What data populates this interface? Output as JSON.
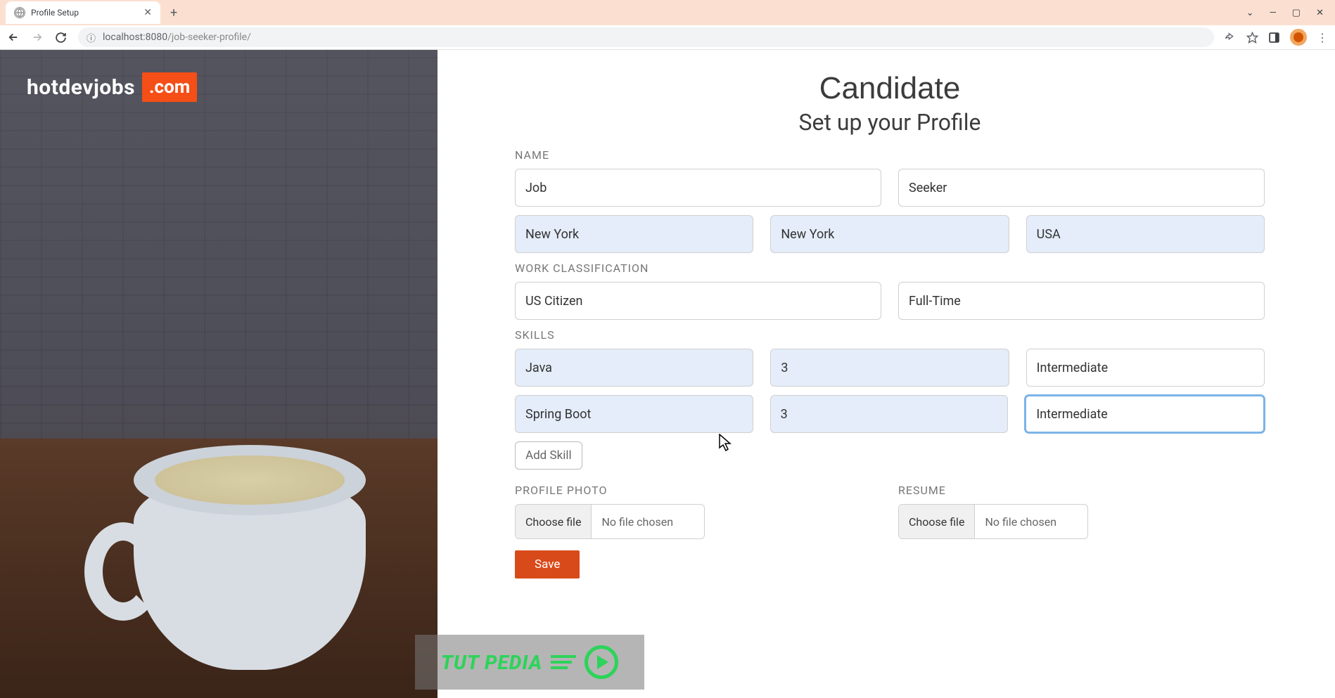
{
  "browser": {
    "tab_title": "Profile Setup",
    "url_host": "localhost:8080",
    "url_path": "/job-seeker-profile/"
  },
  "logo": {
    "text": "hotdevjobs",
    "badge": ".com"
  },
  "heading": {
    "title": "Candidate",
    "subtitle": "Set up your Profile"
  },
  "labels": {
    "name": "NAME",
    "work": "WORK CLASSIFICATION",
    "skills": "SKILLS",
    "photo": "PROFILE PHOTO",
    "resume": "RESUME"
  },
  "name": {
    "first": "Job",
    "last": "Seeker",
    "city": "New York",
    "state": "New York",
    "country": "USA"
  },
  "work": {
    "classification": "US Citizen",
    "type": "Full-Time"
  },
  "skills": [
    {
      "name": "Java",
      "years": "3",
      "level": "Intermediate"
    },
    {
      "name": "Spring Boot",
      "years": "3",
      "level": "Intermediate"
    }
  ],
  "buttons": {
    "add_skill": "Add Skill",
    "choose_file": "Choose file",
    "no_file": "No file chosen",
    "save": "Save"
  },
  "watermark": "TUT PEDIA"
}
